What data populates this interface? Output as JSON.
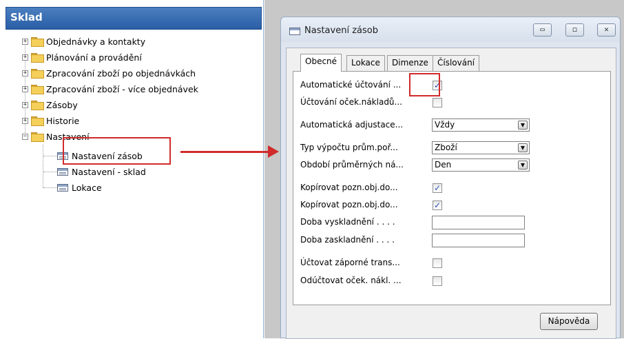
{
  "nav": {
    "title": "Sklad",
    "items": [
      {
        "label": "Objednávky a kontakty",
        "expander": "+"
      },
      {
        "label": "Plánování a provádění",
        "expander": "+"
      },
      {
        "label": "Zpracování zboží po objednávkách",
        "expander": "+"
      },
      {
        "label": "Zpracování zboží - více objednávek",
        "expander": "+"
      },
      {
        "label": "Zásoby",
        "expander": "+"
      },
      {
        "label": "Historie",
        "expander": "+"
      },
      {
        "label": "Nastavení",
        "expander": "−"
      }
    ],
    "children": [
      {
        "label": "Nastavení zásob",
        "selected": true
      },
      {
        "label": "Nastavení - sklad"
      },
      {
        "label": "Lokace"
      }
    ]
  },
  "dialog": {
    "title": "Nastavení zásob",
    "buttons": {
      "minimize": "▭",
      "maximize": "◻",
      "close": "✕"
    },
    "tabs": [
      "Obecné",
      "Lokace",
      "Dimenze",
      "Číslování"
    ],
    "active_tab": "Obecné",
    "fields": {
      "auto_posting": {
        "label": "Automatické účtování ...",
        "checked": true,
        "mark": "✓"
      },
      "expected_cost_posting": {
        "label": "Účtování oček.nákladů...",
        "checked": false
      },
      "auto_adjustment": {
        "label": "Automatická adjustace...",
        "value": "Vždy"
      },
      "avg_cost_type": {
        "label": "Typ výpočtu prům.poř...",
        "value": "Zboží"
      },
      "avg_cost_period": {
        "label": "Období průměrných ná...",
        "value": "Den"
      },
      "copy_comments_1": {
        "label": "Kopírovat pozn.obj.do...",
        "checked": true,
        "mark": "✓"
      },
      "copy_comments_2": {
        "label": "Kopírovat pozn.obj.do...",
        "checked": true,
        "mark": "✓"
      },
      "outbound_time": {
        "label": "Doba vyskladnění . . . .",
        "value": ""
      },
      "inbound_time": {
        "label": "Doba zaskladnění . . . .",
        "value": ""
      },
      "post_negative": {
        "label": "Účtovat záporné trans...",
        "checked": false
      },
      "unpost_expected": {
        "label": "Odúčtovat oček. nákl. ...",
        "checked": false
      }
    },
    "help_label": "Nápověda"
  },
  "colors": {
    "highlight": "#d12a2a",
    "nav_header": "#2a5ea6"
  }
}
